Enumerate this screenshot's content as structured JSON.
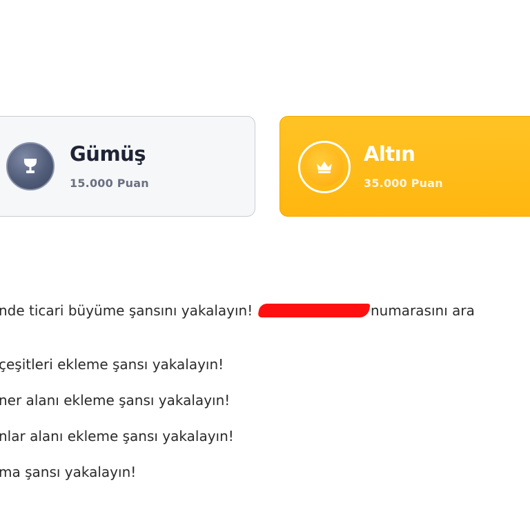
{
  "tiers": [
    {
      "name": "Gümüş",
      "points": "15.000 Puan",
      "icon": "trophy-icon",
      "color": "#525d7a"
    },
    {
      "name": "Altın",
      "points": "35.000 Puan",
      "icon": "crown-icon",
      "color": "#ffb60f"
    }
  ],
  "content": {
    "intro_before": "nde ticari büyüme şansını yakalayın!",
    "intro_after": "numarasını ara",
    "benefits": [
      "çeşitleri ekleme şansı yakalayın!",
      "ner alanı ekleme şansı yakalayın!",
      "nlar alanı ekleme şansı yakalayın!",
      "ma şansı yakalayın!"
    ]
  },
  "colors": {
    "text": "#2a2a2a",
    "redaction": "#ff1010"
  }
}
